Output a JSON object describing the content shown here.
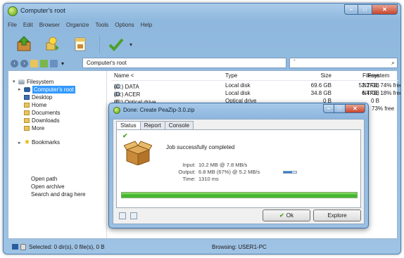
{
  "window": {
    "title": "Computer's root"
  },
  "menu": [
    "File",
    "Edit",
    "Browser",
    "Organize",
    "Tools",
    "Options",
    "Help"
  ],
  "address": {
    "path": "Computer's root",
    "search_placeholder": "*"
  },
  "sidebar": {
    "tree": [
      {
        "label": "Filesystem",
        "icon": "filesystem-icon"
      },
      {
        "label": "Computer's root",
        "icon": "computer-icon",
        "selected": true
      },
      {
        "label": "Desktop",
        "icon": "folder-icon"
      },
      {
        "label": "Home",
        "icon": "folder-icon"
      },
      {
        "label": "Documents",
        "icon": "folder-icon"
      },
      {
        "label": "Downloads",
        "icon": "folder-icon"
      },
      {
        "label": "More",
        "icon": "folder-icon"
      }
    ],
    "bookmarks_label": "Bookmarks",
    "links": [
      "Open path",
      "Open archive",
      "Search and drag here"
    ]
  },
  "filelist": {
    "columns": {
      "name": "Name <",
      "type": "Type",
      "size": "Size",
      "free": "Free",
      "filesystem": "Filesystem"
    },
    "rows": [
      {
        "name": "(C:) DATA",
        "type": "Local disk",
        "size": "69.6 GB",
        "free": "52.2 GB",
        "filesystem": "NTFS, 74% free"
      },
      {
        "name": "(D:) ACER",
        "type": "Local disk",
        "size": "34.8 GB",
        "free": "6.4 GB",
        "filesystem": "NTFS, 18% free"
      },
      {
        "name": "(E:) Optical drive",
        "type": "Optical drive",
        "size": "0 B",
        "free": "0 B",
        "filesystem": ""
      }
    ],
    "partial_row_fs": "73% free"
  },
  "statusbar": {
    "selected": "Selected: 0 dir(s), 0 file(s), 0 B",
    "browsing": "Browsing: USER1-PC"
  },
  "dialog": {
    "title": "Done: Create PeaZip-3.0.zip",
    "tabs": [
      "Status",
      "Report",
      "Console"
    ],
    "message": "Job successfully completed",
    "input_label": "Input:",
    "input_value": "10.2 MB @ 7.8 MB/s",
    "output_label": "Output:",
    "output_value": "6.8 MB (67%) @ 5.2 MB/s",
    "output_ratio": 0.67,
    "time_label": "Time:",
    "time_value": "1310 ms",
    "progress": 1.0,
    "ok_label": "Ok",
    "explore_label": "Explore"
  },
  "colors": {
    "accent": "#3399ff",
    "progress": "#3bb02a",
    "frame": "#9fc3e4"
  }
}
